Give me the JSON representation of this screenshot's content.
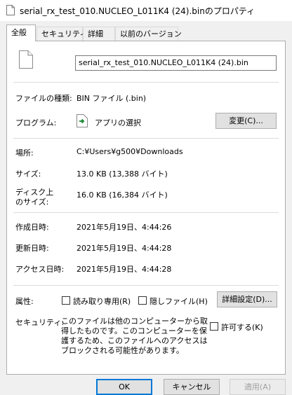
{
  "window": {
    "title": "serial_rx_test_010.NUCLEO_L011K4 (24).binのプロパティ"
  },
  "tabs": [
    "全般",
    "セキュリティ",
    "詳細",
    "以前のバージョン"
  ],
  "general": {
    "file_name": "serial_rx_test_010.NUCLEO_L011K4 (24).bin",
    "file_type_label": "ファイルの種類:",
    "file_type_value": "BIN ファイル (.bin)",
    "program_label": "プログラム:",
    "program_value": "アプリの選択",
    "change_button": "変更(C)...",
    "location_label": "場所:",
    "location_value": "C:¥Users¥g500¥Downloads",
    "size_label": "サイズ:",
    "size_value": "13.0 KB (13,388 バイト)",
    "disk_size_label_1": "ディスク上",
    "disk_size_label_2": "のサイズ:",
    "disk_size_value": "16.0 KB (16,384 バイト)",
    "created_label": "作成日時:",
    "created_value": "2021年5月19日、4:44:26",
    "modified_label": "更新日時:",
    "modified_value": "2021年5月19日、4:44:28",
    "accessed_label": "アクセス日時:",
    "accessed_value": "2021年5月19日、4:44:28",
    "attributes_label": "属性:",
    "readonly_label": "読み取り専用(R)",
    "hidden_label": "隠しファイル(H)",
    "advanced_button": "詳細設定(D)...",
    "security_label": "セキュリティ:",
    "security_text": "このファイルは他のコンピューターから取得したものです。このコンピューターを保護するため、このファイルへのアクセスはブロックされる可能性があります。",
    "unblock_label": "許可する(K)"
  },
  "footer": {
    "ok": "OK",
    "cancel": "キャンセル",
    "apply": "適用(A)"
  },
  "icons": {
    "file": "file-icon",
    "program": "app-chooser-icon"
  }
}
